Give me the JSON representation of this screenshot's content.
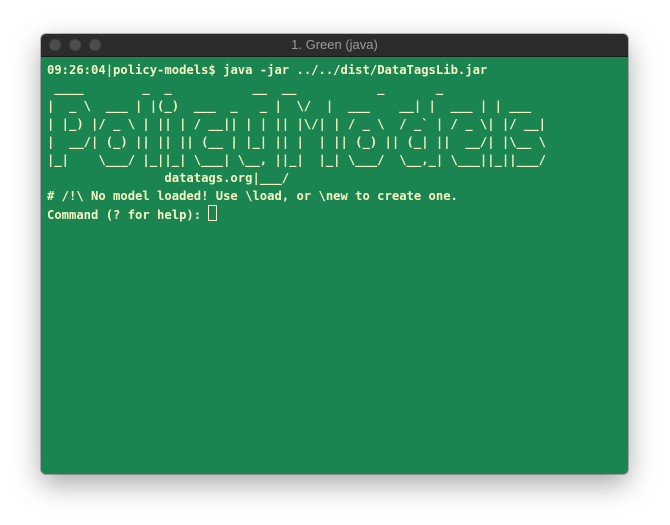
{
  "window": {
    "title": "1. Green (java)"
  },
  "terminal": {
    "command_line": {
      "prompt": "09:26:04|policy-models$",
      "command": " java -jar ../../dist/DataTagsLib.jar"
    },
    "banner_lines": [
      " ____        _  _           __  __           _       _",
      "|  _ \\  ___ | |(_)  ___  _   _ |  \\/  |  ___    __| |  ___ | | ___",
      "| |_) |/ _ \\ | || | / __|| | | || |\\/| | / _ \\  / _` | / _ \\| |/ __|",
      "|  __/| (_) || || || (__ | |_| || |  | || (_) || (_| ||  __/| |\\__ \\",
      "|_|    \\___/ |_||_| \\___| \\__, ||_|  |_| \\___/  \\__,_| \\___||_||___/",
      "                datatags.org|___/"
    ],
    "message": "# /!\\ No model loaded! Use \\load, or \\new to create one.",
    "input_prompt": "Command (? for help): "
  },
  "colors": {
    "terminal_background": "#1a8550",
    "terminal_foreground": "#f6f5c4",
    "titlebar_background": "#2c2c2c"
  }
}
